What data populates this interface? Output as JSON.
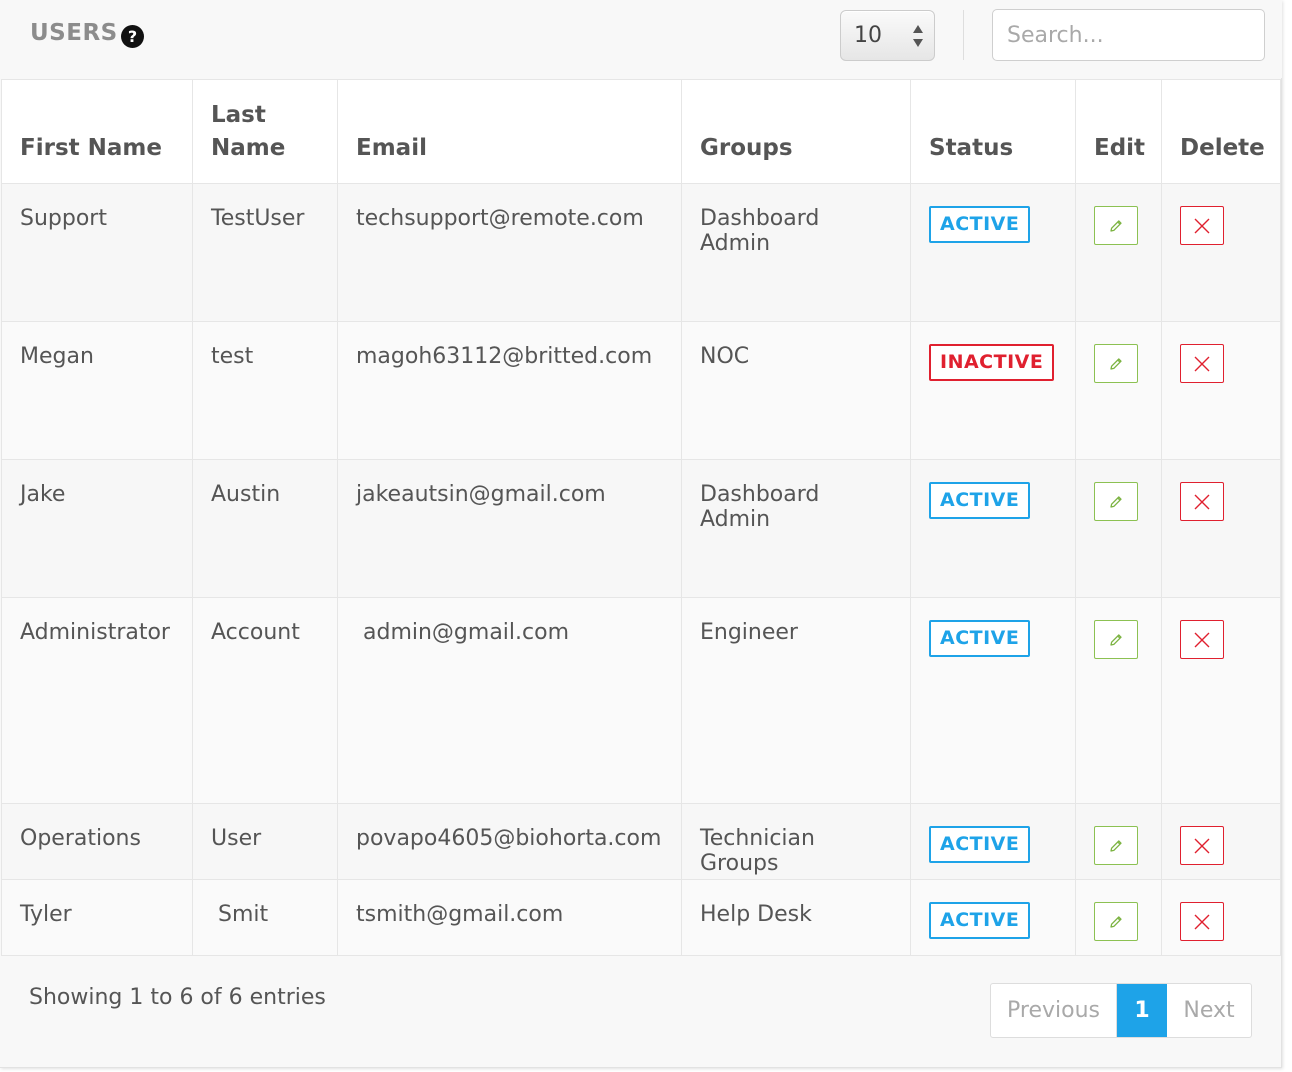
{
  "header": {
    "title": "USERS",
    "help_icon": "?",
    "page_length": "10",
    "search_placeholder": "Search..."
  },
  "table": {
    "columns": [
      "First Name",
      "Last Name",
      "Email",
      "Groups",
      "Status",
      "Edit",
      "Delete"
    ],
    "rows": [
      {
        "first": "Support",
        "last": "TestUser",
        "email": "techsupport@remote.com",
        "group": "Dashboard Admin",
        "status": "ACTIVE"
      },
      {
        "first": "Megan",
        "last": "test",
        "email": "magoh63112@britted.com",
        "group": "NOC",
        "status": "INACTIVE"
      },
      {
        "first": "Jake",
        "last": "Austin",
        "email": "jakeautsin@gmail.com",
        "group": "Dashboard Admin",
        "status": "ACTIVE"
      },
      {
        "first": "Administrator",
        "last": "Account",
        "email": " admin@gmail.com",
        "group": "Engineer",
        "status": "ACTIVE"
      },
      {
        "first": "Operations",
        "last": "User",
        "email": "povapo4605@biohorta.com",
        "group": "Technician Groups",
        "status": "ACTIVE"
      },
      {
        "first": "Tyler",
        "last": " Smit",
        "email": "tsmith@gmail.com",
        "group": "Help Desk",
        "status": "ACTIVE"
      }
    ]
  },
  "footer": {
    "info": "Showing 1 to 6 of 6 entries",
    "previous": "Previous",
    "current_page": "1",
    "next": "Next"
  },
  "colors": {
    "active": "#1ea3e8",
    "inactive": "#e0202f",
    "edit": "#8cc152",
    "delete": "#e0202f",
    "pagination_active": "#1ea3e8"
  }
}
